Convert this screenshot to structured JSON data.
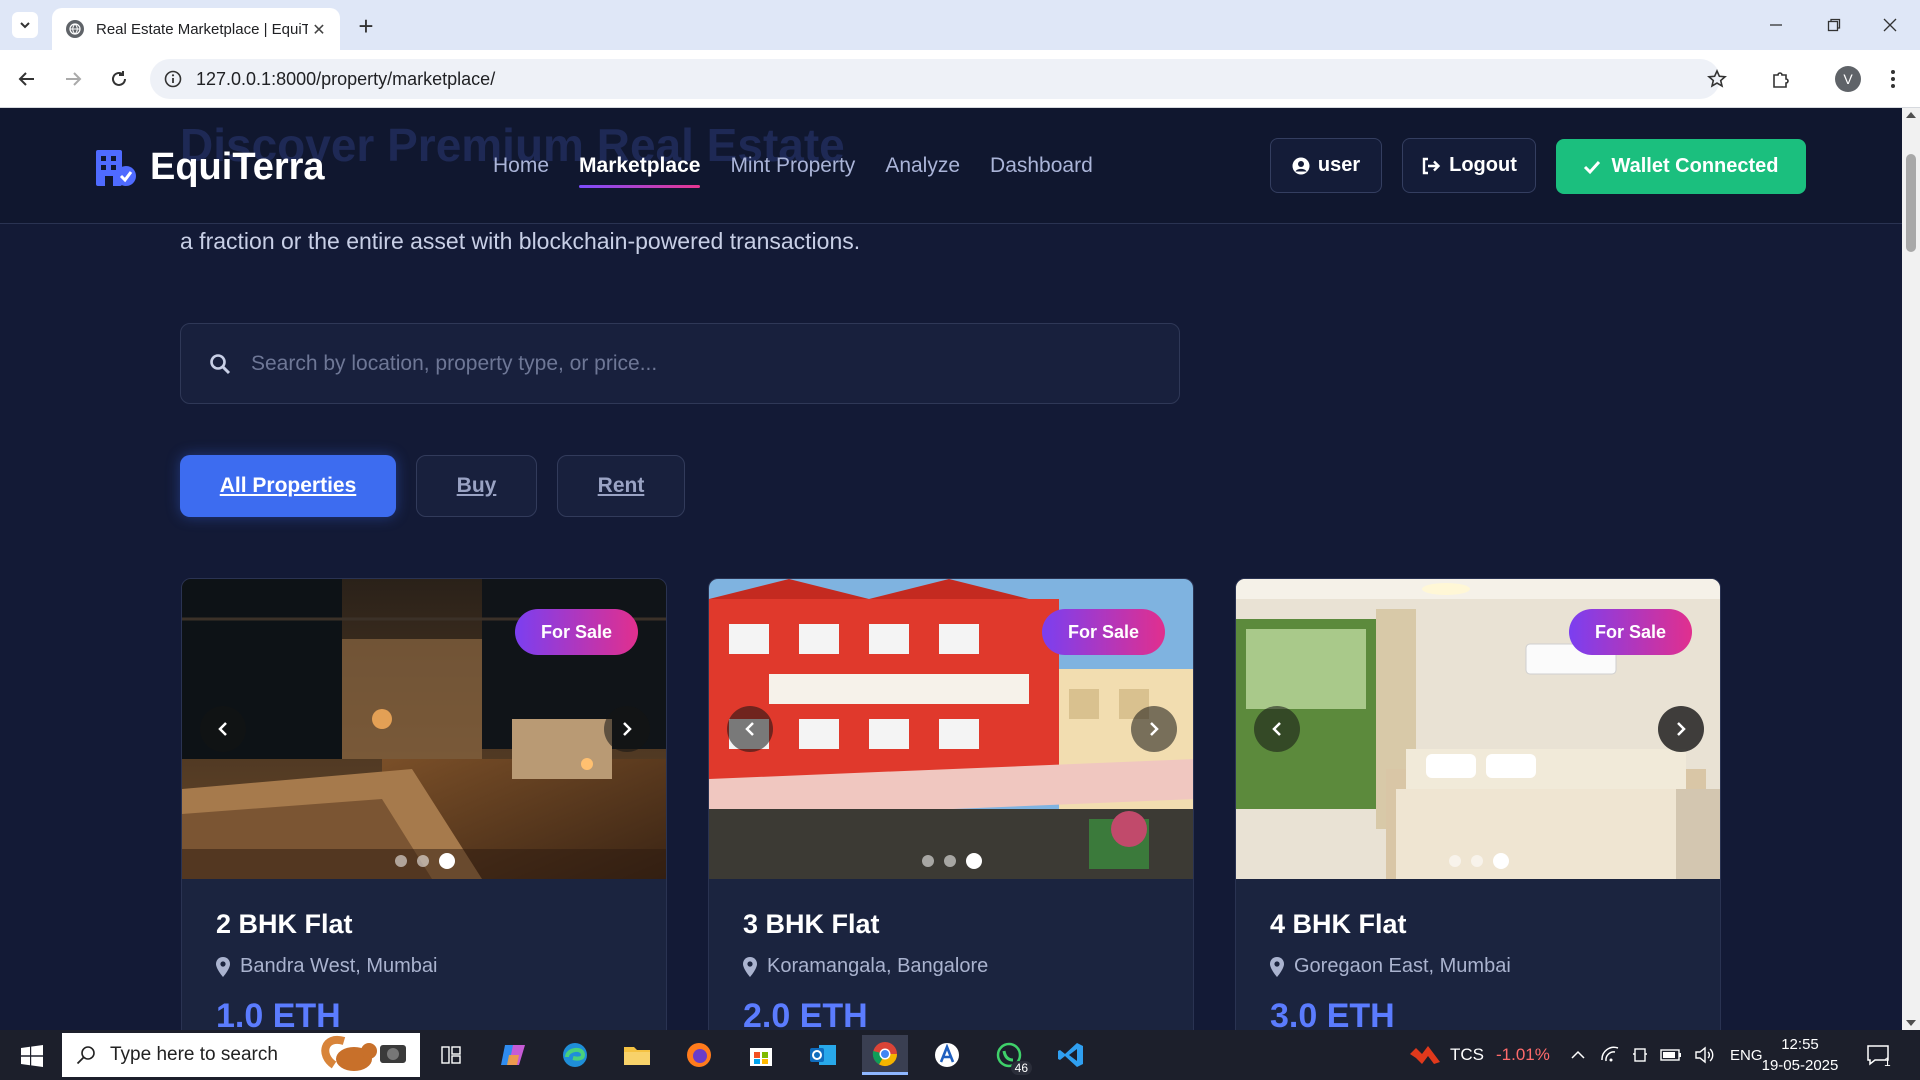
{
  "browser": {
    "tab_title": "Real Estate Marketplace | EquiTerra",
    "url": "127.0.0.1:8000/property/marketplace/",
    "profile_initial": "V"
  },
  "header": {
    "ghost_heading": "Discover Premium Real Estate",
    "brand": "EquiTerra",
    "nav": [
      {
        "label": "Home"
      },
      {
        "label": "Marketplace",
        "active": true
      },
      {
        "label": "Mint Property"
      },
      {
        "label": "Analyze"
      },
      {
        "label": "Dashboard"
      }
    ],
    "user_label": "user",
    "logout_label": "Logout",
    "wallet_label": "Wallet Connected"
  },
  "hero": {
    "text": "a fraction or the entire asset with blockchain-powered transactions."
  },
  "search": {
    "placeholder": "Search by location, property type, or price..."
  },
  "filters": [
    {
      "label": "All Properties",
      "active": true
    },
    {
      "label": "Buy"
    },
    {
      "label": "Rent"
    }
  ],
  "properties": [
    {
      "title": "2 BHK Flat",
      "location": "Bandra West, Mumbai",
      "price": "1.0 ETH",
      "badge": "For Sale"
    },
    {
      "title": "3 BHK Flat",
      "location": "Koramangala, Bangalore",
      "price": "2.0 ETH",
      "badge": "For Sale"
    },
    {
      "title": "4 BHK Flat",
      "location": "Goregaon East, Mumbai",
      "price": "3.0 ETH",
      "badge": "For Sale"
    }
  ],
  "carousel": {
    "active_slide": 3,
    "total_slides": 3
  },
  "taskbar": {
    "search_placeholder": "Type here to search",
    "stock_name": "TCS",
    "stock_change": "-1.01%",
    "whatsapp_badge": "46",
    "language": "ENG",
    "time": "12:55",
    "date": "19-05-2025",
    "notifications": "1"
  },
  "colors": {
    "page_bg": "#131a36",
    "accent_blue": "#3d6cf0",
    "wallet_green": "#1bbf7e",
    "badge_gradient_start": "#7b3ff0",
    "badge_gradient_end": "#e12f8e"
  }
}
